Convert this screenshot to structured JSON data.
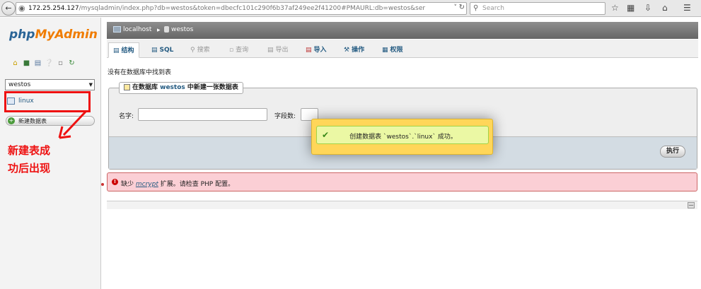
{
  "browser": {
    "url_host": "172.25.254.127",
    "url_rest": "/mysqladmin/index.php?db=westos&token=dbecfc101c290f6b37af249ee2f41200#PMAURL:db=westos&ser",
    "search_placeholder": "Search"
  },
  "sidebar": {
    "logo_a": "php",
    "logo_b": "MyAdmin",
    "db_selected": "westos",
    "table_item": "linux",
    "new_table_label": "新建数据表"
  },
  "annotation": {
    "line1": "新建表成",
    "line2": "功后出现",
    "color": "#ee1111"
  },
  "breadcrumb": {
    "server": "localhost",
    "database": "westos"
  },
  "tabs": [
    {
      "label": "结构"
    },
    {
      "label": "SQL"
    },
    {
      "label": "搜索"
    },
    {
      "label": "查询"
    },
    {
      "label": "导出"
    },
    {
      "label": "导入"
    },
    {
      "label": "操作"
    },
    {
      "label": "权限"
    }
  ],
  "main": {
    "no_tables_msg": "没有在数据库中找到表",
    "create_legend_pre": "在数据库 ",
    "create_legend_db": "westos",
    "create_legend_post": " 中新建一张数据表",
    "name_label": "名字:",
    "fields_label": "字段数:",
    "go_label": "执行",
    "name_value": "",
    "fields_value": ""
  },
  "error": {
    "pre": "缺少 ",
    "link": "mcrypt",
    "post": " 扩展。请检查 PHP 配置。"
  },
  "popup": {
    "message": "创建数据表 `westos`.`linux` 成功。"
  },
  "colors": {
    "accent": "#235a81",
    "brand_orange": "#f07c00",
    "error_bg": "#fbcfd5",
    "success_bg": "#ebf8a4"
  }
}
